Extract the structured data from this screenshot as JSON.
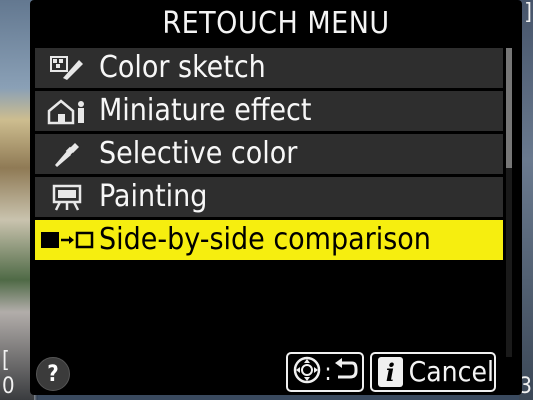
{
  "header": {
    "title": "RETOUCH MENU"
  },
  "menu": {
    "items": [
      {
        "label": "Color sketch",
        "icon": "color-sketch-icon",
        "selected": false
      },
      {
        "label": "Miniature effect",
        "icon": "miniature-effect-icon",
        "selected": false
      },
      {
        "label": "Selective color",
        "icon": "selective-color-icon",
        "selected": false
      },
      {
        "label": "Painting",
        "icon": "painting-icon",
        "selected": false
      },
      {
        "label": "Side-by-side comparison",
        "icon": "side-by-side-icon",
        "selected": true
      }
    ]
  },
  "footer": {
    "help": "?",
    "info_glyph": "i",
    "cancel_label": "Cancel"
  },
  "colors": {
    "highlight": "#f6ee0f",
    "row": "#2e2e2e",
    "panel": "#000000"
  }
}
